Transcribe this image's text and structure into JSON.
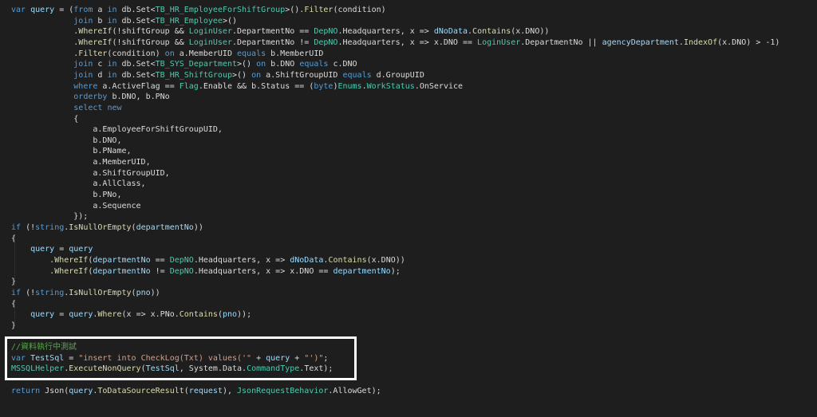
{
  "editor": {
    "lines": [
      [
        {
          "t": "var ",
          "c": "keyword"
        },
        {
          "t": "query",
          "c": "var"
        },
        {
          "t": " = (",
          "c": "plain"
        },
        {
          "t": "from",
          "c": "keyword"
        },
        {
          "t": " a ",
          "c": "plain"
        },
        {
          "t": "in",
          "c": "keyword"
        },
        {
          "t": " db.Set<",
          "c": "plain"
        },
        {
          "t": "TB_HR_EmployeeForShiftGroup",
          "c": "type"
        },
        {
          "t": ">().",
          "c": "plain"
        },
        {
          "t": "Filter",
          "c": "method"
        },
        {
          "t": "(condition)",
          "c": "plain"
        }
      ],
      [
        {
          "t": "             ",
          "c": "plain"
        },
        {
          "t": "join",
          "c": "keyword"
        },
        {
          "t": " b ",
          "c": "plain"
        },
        {
          "t": "in",
          "c": "keyword"
        },
        {
          "t": " db.Set<",
          "c": "plain"
        },
        {
          "t": "TB_HR_Employee",
          "c": "type"
        },
        {
          "t": ">()",
          "c": "plain"
        }
      ],
      [
        {
          "t": "             .",
          "c": "plain"
        },
        {
          "t": "WhereIf",
          "c": "method"
        },
        {
          "t": "(!shiftGroup && ",
          "c": "plain"
        },
        {
          "t": "LoginUser",
          "c": "type"
        },
        {
          "t": ".DepartmentNo == ",
          "c": "plain"
        },
        {
          "t": "DepNO",
          "c": "type"
        },
        {
          "t": ".Headquarters, x => ",
          "c": "plain"
        },
        {
          "t": "dNoData",
          "c": "var"
        },
        {
          "t": ".",
          "c": "plain"
        },
        {
          "t": "Contains",
          "c": "method"
        },
        {
          "t": "(x.DNO))",
          "c": "plain"
        }
      ],
      [
        {
          "t": "             .",
          "c": "plain"
        },
        {
          "t": "WhereIf",
          "c": "method"
        },
        {
          "t": "(!shiftGroup && ",
          "c": "plain"
        },
        {
          "t": "LoginUser",
          "c": "type"
        },
        {
          "t": ".DepartmentNo != ",
          "c": "plain"
        },
        {
          "t": "DepNO",
          "c": "type"
        },
        {
          "t": ".Headquarters, x => x.DNO == ",
          "c": "plain"
        },
        {
          "t": "LoginUser",
          "c": "type"
        },
        {
          "t": ".DepartmentNo || ",
          "c": "plain"
        },
        {
          "t": "agencyDepartment",
          "c": "var"
        },
        {
          "t": ".",
          "c": "plain"
        },
        {
          "t": "IndexOf",
          "c": "method"
        },
        {
          "t": "(x.DNO) > -1)",
          "c": "plain"
        }
      ],
      [
        {
          "t": "             .",
          "c": "plain"
        },
        {
          "t": "Filter",
          "c": "method"
        },
        {
          "t": "(condition) ",
          "c": "plain"
        },
        {
          "t": "on",
          "c": "keyword"
        },
        {
          "t": " a.MemberUID ",
          "c": "plain"
        },
        {
          "t": "equals",
          "c": "keyword"
        },
        {
          "t": " b.MemberUID",
          "c": "plain"
        }
      ],
      [
        {
          "t": "             ",
          "c": "plain"
        },
        {
          "t": "join",
          "c": "keyword"
        },
        {
          "t": " c ",
          "c": "plain"
        },
        {
          "t": "in",
          "c": "keyword"
        },
        {
          "t": " db.Set<",
          "c": "plain"
        },
        {
          "t": "TB_SYS_Department",
          "c": "type"
        },
        {
          "t": ">() ",
          "c": "plain"
        },
        {
          "t": "on",
          "c": "keyword"
        },
        {
          "t": " b.DNO ",
          "c": "plain"
        },
        {
          "t": "equals",
          "c": "keyword"
        },
        {
          "t": " c.DNO",
          "c": "plain"
        }
      ],
      [
        {
          "t": "             ",
          "c": "plain"
        },
        {
          "t": "join",
          "c": "keyword"
        },
        {
          "t": " d ",
          "c": "plain"
        },
        {
          "t": "in",
          "c": "keyword"
        },
        {
          "t": " db.Set<",
          "c": "plain"
        },
        {
          "t": "TB_HR_ShiftGroup",
          "c": "type"
        },
        {
          "t": ">() ",
          "c": "plain"
        },
        {
          "t": "on",
          "c": "keyword"
        },
        {
          "t": " a.ShiftGroupUID ",
          "c": "plain"
        },
        {
          "t": "equals",
          "c": "keyword"
        },
        {
          "t": " d.GroupUID",
          "c": "plain"
        }
      ],
      [
        {
          "t": "             ",
          "c": "plain"
        },
        {
          "t": "where",
          "c": "keyword"
        },
        {
          "t": " a.ActiveFlag == ",
          "c": "plain"
        },
        {
          "t": "Flag",
          "c": "type"
        },
        {
          "t": ".Enable && b.Status == (",
          "c": "plain"
        },
        {
          "t": "byte",
          "c": "keyword"
        },
        {
          "t": ")",
          "c": "plain"
        },
        {
          "t": "Enums",
          "c": "type"
        },
        {
          "t": ".",
          "c": "plain"
        },
        {
          "t": "WorkStatus",
          "c": "type"
        },
        {
          "t": ".OnService",
          "c": "plain"
        }
      ],
      [
        {
          "t": "             ",
          "c": "plain"
        },
        {
          "t": "orderby",
          "c": "keyword"
        },
        {
          "t": " b.DNO, b.PNo",
          "c": "plain"
        }
      ],
      [
        {
          "t": "             ",
          "c": "plain"
        },
        {
          "t": "select",
          "c": "keyword"
        },
        {
          "t": " ",
          "c": "plain"
        },
        {
          "t": "new",
          "c": "keyword"
        }
      ],
      [
        {
          "t": "             {",
          "c": "plain"
        }
      ],
      [
        {
          "t": "                 a.EmployeeForShiftGroupUID,",
          "c": "plain"
        }
      ],
      [
        {
          "t": "                 b.DNO,",
          "c": "plain"
        }
      ],
      [
        {
          "t": "                 b.PName,",
          "c": "plain"
        }
      ],
      [
        {
          "t": "                 a.MemberUID,",
          "c": "plain"
        }
      ],
      [
        {
          "t": "                 a.ShiftGroupUID,",
          "c": "plain"
        }
      ],
      [
        {
          "t": "                 a.AllClass,",
          "c": "plain"
        }
      ],
      [
        {
          "t": "                 b.PNo,",
          "c": "plain"
        }
      ],
      [
        {
          "t": "                 a.Sequence",
          "c": "plain"
        }
      ],
      [
        {
          "t": "             });",
          "c": "plain"
        }
      ],
      [
        {
          "t": "if",
          "c": "keyword"
        },
        {
          "t": " (!",
          "c": "plain"
        },
        {
          "t": "string",
          "c": "keyword"
        },
        {
          "t": ".",
          "c": "plain"
        },
        {
          "t": "IsNullOrEmpty",
          "c": "method"
        },
        {
          "t": "(",
          "c": "plain"
        },
        {
          "t": "departmentNo",
          "c": "var"
        },
        {
          "t": "))",
          "c": "plain"
        }
      ],
      [
        {
          "t": "{",
          "c": "plain"
        }
      ],
      [
        {
          "t": "    ",
          "c": "plain"
        },
        {
          "t": "query",
          "c": "var"
        },
        {
          "t": " = ",
          "c": "plain"
        },
        {
          "t": "query",
          "c": "var"
        }
      ],
      [
        {
          "t": "        .",
          "c": "plain"
        },
        {
          "t": "WhereIf",
          "c": "method"
        },
        {
          "t": "(",
          "c": "plain"
        },
        {
          "t": "departmentNo",
          "c": "var"
        },
        {
          "t": " == ",
          "c": "plain"
        },
        {
          "t": "DepNO",
          "c": "type"
        },
        {
          "t": ".Headquarters, x => ",
          "c": "plain"
        },
        {
          "t": "dNoData",
          "c": "var"
        },
        {
          "t": ".",
          "c": "plain"
        },
        {
          "t": "Contains",
          "c": "method"
        },
        {
          "t": "(x.DNO))",
          "c": "plain"
        }
      ],
      [
        {
          "t": "        .",
          "c": "plain"
        },
        {
          "t": "WhereIf",
          "c": "method"
        },
        {
          "t": "(",
          "c": "plain"
        },
        {
          "t": "departmentNo",
          "c": "var"
        },
        {
          "t": " != ",
          "c": "plain"
        },
        {
          "t": "DepNO",
          "c": "type"
        },
        {
          "t": ".Headquarters, x => x.DNO == ",
          "c": "plain"
        },
        {
          "t": "departmentNo",
          "c": "var"
        },
        {
          "t": ");",
          "c": "plain"
        }
      ],
      [
        {
          "t": "}",
          "c": "plain"
        }
      ],
      [
        {
          "t": "if",
          "c": "keyword"
        },
        {
          "t": " (!",
          "c": "plain"
        },
        {
          "t": "string",
          "c": "keyword"
        },
        {
          "t": ".",
          "c": "plain"
        },
        {
          "t": "IsNullOrEmpty",
          "c": "method"
        },
        {
          "t": "(",
          "c": "plain"
        },
        {
          "t": "pno",
          "c": "var"
        },
        {
          "t": "))",
          "c": "plain"
        }
      ],
      [
        {
          "t": "{",
          "c": "plain"
        }
      ],
      [
        {
          "t": "    ",
          "c": "plain"
        },
        {
          "t": "query",
          "c": "var"
        },
        {
          "t": " = ",
          "c": "plain"
        },
        {
          "t": "query",
          "c": "var"
        },
        {
          "t": ".",
          "c": "plain"
        },
        {
          "t": "Where",
          "c": "method"
        },
        {
          "t": "(x => x.PNo.",
          "c": "plain"
        },
        {
          "t": "Contains",
          "c": "method"
        },
        {
          "t": "(",
          "c": "plain"
        },
        {
          "t": "pno",
          "c": "var"
        },
        {
          "t": "));",
          "c": "plain"
        }
      ],
      [
        {
          "t": "}",
          "c": "plain"
        }
      ],
      [
        {
          "t": "",
          "c": "plain"
        }
      ],
      [
        {
          "t": "//資料執行中測試",
          "c": "comment"
        }
      ],
      [
        {
          "t": "var",
          "c": "keyword"
        },
        {
          "t": " ",
          "c": "plain"
        },
        {
          "t": "TestSql",
          "c": "var"
        },
        {
          "t": " = ",
          "c": "plain"
        },
        {
          "t": "\"insert into CheckLog(Txt) values('\"",
          "c": "string"
        },
        {
          "t": " + ",
          "c": "plain"
        },
        {
          "t": "query",
          "c": "var"
        },
        {
          "t": " + ",
          "c": "plain"
        },
        {
          "t": "\"')\"",
          "c": "string"
        },
        {
          "t": ";",
          "c": "plain"
        }
      ],
      [
        {
          "t": "MSSQLHelper",
          "c": "type"
        },
        {
          "t": ".",
          "c": "plain"
        },
        {
          "t": "ExecuteNonQuery",
          "c": "method"
        },
        {
          "t": "(",
          "c": "plain"
        },
        {
          "t": "TestSql",
          "c": "var"
        },
        {
          "t": ", System.Data.",
          "c": "plain"
        },
        {
          "t": "CommandType",
          "c": "type"
        },
        {
          "t": ".Text);",
          "c": "plain"
        }
      ],
      [
        {
          "t": "",
          "c": "plain"
        }
      ],
      [
        {
          "t": "return",
          "c": "keyword"
        },
        {
          "t": " Json(",
          "c": "plain"
        },
        {
          "t": "query",
          "c": "var"
        },
        {
          "t": ".",
          "c": "plain"
        },
        {
          "t": "ToDataSourceResult",
          "c": "method"
        },
        {
          "t": "(",
          "c": "plain"
        },
        {
          "t": "request",
          "c": "var"
        },
        {
          "t": "), ",
          "c": "plain"
        },
        {
          "t": "JsonRequestBehavior",
          "c": "type"
        },
        {
          "t": ".AllowGet);",
          "c": "plain"
        }
      ]
    ],
    "colors": {
      "background": "#1e1e1e",
      "keyword": "#569cd6",
      "type": "#4ec9b0",
      "method": "#dcdcaa",
      "string": "#d69d85",
      "comment": "#57a64a",
      "variable": "#9cdcfe",
      "plain": "#dcdcdc",
      "highlight_box": "#ffffff"
    }
  }
}
